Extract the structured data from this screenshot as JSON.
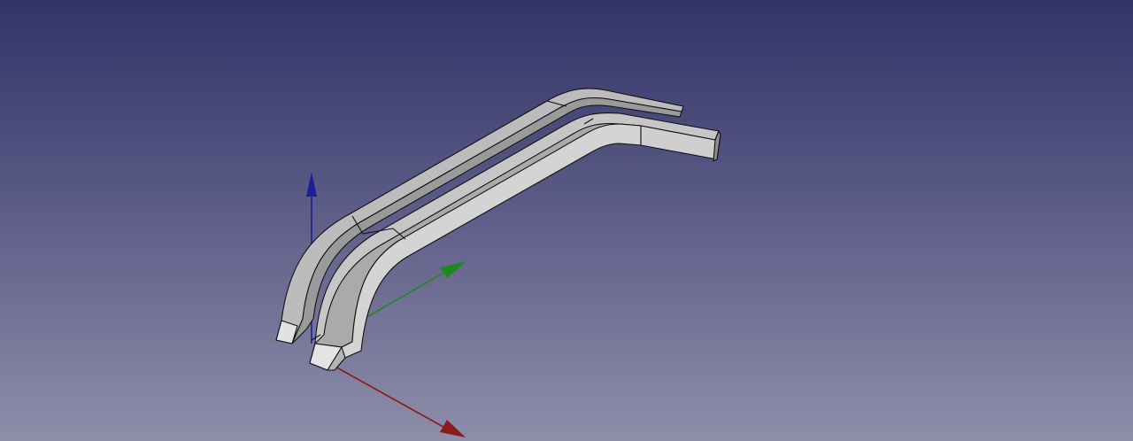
{
  "viewport": {
    "background_top": "#333366",
    "background_bottom": "#8e8eaa"
  },
  "axes": {
    "x_color": "#8b1a1a",
    "y_color": "#1e8a1e",
    "z_color": "#1e1e96"
  },
  "model": {
    "face_light": "#c8c8c8",
    "face_mid": "#a8a8a8",
    "face_dark": "#8a8a8a",
    "edge_color": "#111111"
  }
}
